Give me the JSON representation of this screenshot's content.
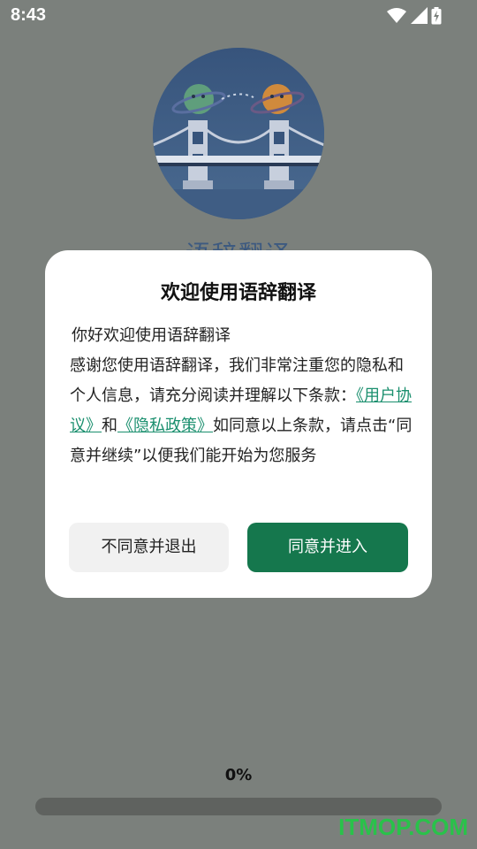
{
  "status_bar": {
    "time": "8:43"
  },
  "splash": {
    "app_name": "语辞翻译",
    "logo_icon": "planets-bridge-logo"
  },
  "dialog": {
    "title": "欢迎使用语辞翻译",
    "greeting": "你好欢迎使用语辞翻译",
    "body_intro": "感谢您使用语辞翻译，我们非常注重您的隐私和个人信息，请充分阅读并理解以下条款：",
    "user_agreement_link": "《用户协议》",
    "and_text": "和",
    "privacy_policy_link": "《隐私政策》",
    "body_outro": "如同意以上条款，请点击“同意并继续”以便我们能开始为您服务",
    "decline_button": "不同意并退出",
    "agree_button": "同意并进入"
  },
  "progress": {
    "label": "0%",
    "value": 0
  },
  "watermark": "ITMOP.COM",
  "colors": {
    "overlay_background": "#7b807c",
    "primary_green": "#15774d",
    "link_green": "#1a8f6e",
    "dialog_background": "#ffffff",
    "decline_button_background": "#f1f1f1",
    "watermark_green": "#29c24a"
  }
}
